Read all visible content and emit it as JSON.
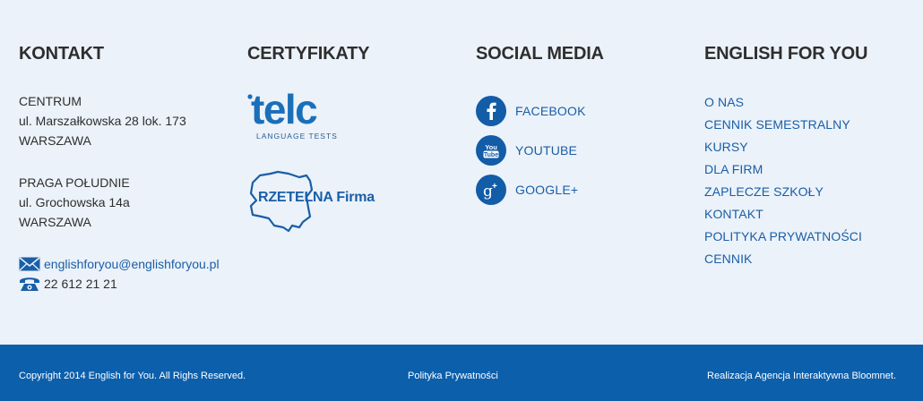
{
  "kontakt": {
    "heading": "KONTAKT",
    "address1": {
      "line1": "CENTRUM",
      "line2": "ul. Marszałkowska 28 lok. 173",
      "line3": "WARSZAWA"
    },
    "address2": {
      "line1": "PRAGA POŁUDNIE",
      "line2": "ul. Grochowska 14a",
      "line3": "WARSZAWA"
    },
    "email": "englishforyou@englishforyou.pl",
    "phone": "22 612 21 21",
    "email_icon": "envelope-icon",
    "phone_icon": "telephone-icon"
  },
  "certyfikaty": {
    "heading": "CERTYFIKATY",
    "telc_logo": {
      "word": "telc",
      "sub": "LANGUAGE TESTS"
    },
    "rzetelna_logo": {
      "text": "RZETELNA Firma"
    }
  },
  "social": {
    "heading": "SOCIAL MEDIA",
    "items": [
      {
        "label": "FACEBOOK",
        "icon": "facebook-icon"
      },
      {
        "label": "YOUTUBE",
        "icon": "youtube-icon"
      },
      {
        "label": "GOOGLE+",
        "icon": "google-plus-icon"
      }
    ]
  },
  "efy": {
    "heading": "ENGLISH FOR YOU",
    "links": [
      "O NAS",
      "CENNIK SEMESTRALNY",
      "KURSY",
      "DLA FIRM",
      "ZAPLECZE SZKOŁY",
      "KONTAKT",
      "POLITYKA PRYWATNOŚCI",
      "CENNIK"
    ]
  },
  "bottom": {
    "copyright": "Copyright 2014 English for You. All Righs Reserved.",
    "privacy": "Polityka Prywatności",
    "credit": "Realizacja Agencja Interaktywna Bloomnet."
  },
  "colors": {
    "background": "#ebf2f9",
    "link": "#1a5ea7",
    "accent": "#0c5fab",
    "heading": "#2e2e2e"
  }
}
